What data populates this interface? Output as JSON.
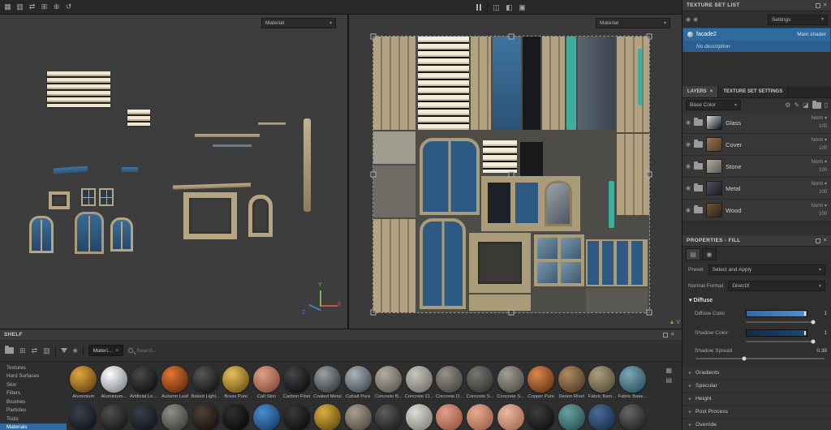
{
  "colors": {
    "accent_blue": "#2f6b9e",
    "viewport_bg": "#3d3d3d",
    "beige": "#b5a583",
    "door_blue": "#2e5f86",
    "teal": "#3fae9e",
    "diffuse_bar": "#3d7fc4",
    "shadow_bar": "#14395e"
  },
  "topbar": {
    "left_icons": [
      {
        "name": "uv-grid-icon",
        "glyph": "▦"
      },
      {
        "name": "layout-grid-icon",
        "glyph": "▥"
      },
      {
        "name": "swap-views-icon",
        "glyph": "⇄"
      },
      {
        "name": "split-view-icon",
        "glyph": "⊞"
      },
      {
        "name": "add-view-icon",
        "glyph": "⊕"
      },
      {
        "name": "history-icon",
        "glyph": "↺"
      }
    ],
    "right_icons": [
      {
        "name": "display-settings-icon",
        "glyph": "◫"
      },
      {
        "name": "render-mode-icon",
        "glyph": "◧"
      },
      {
        "name": "camera-icon",
        "glyph": "▣"
      }
    ]
  },
  "viewport3d": {
    "material_dropdown": "Material",
    "axes": {
      "x": "X",
      "y": "Y",
      "z": "Z"
    }
  },
  "viewport2d": {
    "material_dropdown": "Material",
    "axis_v": "V"
  },
  "texture_set_list": {
    "title": "TEXTURE SET LIST",
    "settings_button": "Settings",
    "set_name": "facade2",
    "shader": "Main shader",
    "description": "No description"
  },
  "layers_panel": {
    "tab_layers": "LAYERS",
    "tab_settings": "TEXTURE SET SETTINGS",
    "channel": "Base Color",
    "layers": [
      {
        "name": "Glass",
        "blend": "Norm",
        "opacity": "100",
        "t1": "#d6dadc",
        "t2": "#10151a"
      },
      {
        "name": "Cover",
        "blend": "Norm",
        "opacity": "100",
        "t1": "#9a7450",
        "t2": "#4e3a26"
      },
      {
        "name": "Stone",
        "blend": "Norm",
        "opacity": "100",
        "t1": "#b0aca2",
        "t2": "#5e5a52"
      },
      {
        "name": "Metal",
        "blend": "Norm",
        "opacity": "100",
        "t1": "#4e525a",
        "t2": "#1a1d22"
      },
      {
        "name": "Wood",
        "blend": "Norm",
        "opacity": "100",
        "t1": "#6e5638",
        "t2": "#2c2216"
      }
    ]
  },
  "properties": {
    "title": "PROPERTIES - FILL",
    "preset_label": "Preset",
    "preset_value": "Select and Apply",
    "normal_format_label": "Normal Format",
    "normal_format_value": "DirectX",
    "diffuse_section": "Diffuse",
    "diffuse_color": {
      "label": "Diffuse Color",
      "value": "1"
    },
    "shadow_color": {
      "label": "Shadow Color",
      "value": "1"
    },
    "shadow_spread": {
      "label": "Shadow Spread",
      "value": "0.38"
    },
    "sections": [
      {
        "label": "Gradients"
      },
      {
        "label": "Specular"
      },
      {
        "label": "Height"
      },
      {
        "label": "Post Process"
      },
      {
        "label": "Override"
      }
    ]
  },
  "shelf": {
    "title": "SHELF",
    "filter_tag": "Materi...",
    "search_placeholder": "Search...",
    "categories": [
      {
        "label": "Textures"
      },
      {
        "label": "Hard Surfaces"
      },
      {
        "label": "Skin"
      },
      {
        "label": "Filters"
      },
      {
        "label": "Brushes"
      },
      {
        "label": "Particles"
      },
      {
        "label": "Tools"
      },
      {
        "label": "Materials",
        "selected": true
      }
    ],
    "materials": [
      {
        "name": "Aluminium",
        "c1": "#e0a83c",
        "c2": "#6e4a14"
      },
      {
        "name": "Aluminium...",
        "c1": "#ffffff",
        "c2": "#8a8f94"
      },
      {
        "name": "Artificial Lea...",
        "c1": "#4a4a4e",
        "c2": "#141416"
      },
      {
        "name": "Autumn Leaf",
        "c1": "#e07830",
        "c2": "#70300e"
      },
      {
        "name": "Baked Light...",
        "c1": "#585858",
        "c2": "#181818"
      },
      {
        "name": "Brass Pure",
        "c1": "#e8c05a",
        "c2": "#7a5c1a"
      },
      {
        "name": "Calf Skin",
        "c1": "#e0a088",
        "c2": "#8a5240"
      },
      {
        "name": "Carbon Fiber",
        "c1": "#46464c",
        "c2": "#121214"
      },
      {
        "name": "Coated Metal",
        "c1": "#9aa0a4",
        "c2": "#3c4044"
      },
      {
        "name": "Cobalt Pure",
        "c1": "#aab2ba",
        "c2": "#4a5258"
      },
      {
        "name": "Concrete B...",
        "c1": "#b4aea2",
        "c2": "#625e54"
      },
      {
        "name": "Concrete Cl...",
        "c1": "#c8c6be",
        "c2": "#787670"
      },
      {
        "name": "Concrete D...",
        "c1": "#969288",
        "c2": "#4c4a44"
      },
      {
        "name": "Concrete S...",
        "c1": "#787872",
        "c2": "#383836"
      },
      {
        "name": "Concrete S...",
        "c1": "#a29e96",
        "c2": "#55524c"
      },
      {
        "name": "Copper Pure",
        "c1": "#da8850",
        "c2": "#6e3a1a"
      },
      {
        "name": "Denim Rivet",
        "c1": "#b08a62",
        "c2": "#5a4228"
      },
      {
        "name": "Fabric Bam...",
        "c1": "#aaa07e",
        "c2": "#5c543e"
      },
      {
        "name": "Fabric Base...",
        "c1": "#7aa8b4",
        "c2": "#34586a"
      }
    ],
    "materials_row2": [
      {
        "name": "",
        "c1": "#3c424e",
        "c2": "#12161e"
      },
      {
        "name": "",
        "c1": "#50504e",
        "c2": "#1a1a1a"
      },
      {
        "name": "",
        "c1": "#3a4048",
        "c2": "#14181e"
      },
      {
        "name": "",
        "c1": "#8e8e8a",
        "c2": "#44443f"
      },
      {
        "name": "",
        "c1": "#4e4238",
        "c2": "#1a140e"
      },
      {
        "name": "",
        "c1": "#303030",
        "c2": "#0c0c0c"
      },
      {
        "name": "",
        "c1": "#4e8cd0",
        "c2": "#1a4474"
      },
      {
        "name": "",
        "c1": "#3a3a3a",
        "c2": "#101010"
      },
      {
        "name": "",
        "c1": "#d8b040",
        "c2": "#6e5210"
      },
      {
        "name": "",
        "c1": "#a89e8e",
        "c2": "#565048"
      },
      {
        "name": "",
        "c1": "#5e5e5e",
        "c2": "#222222"
      },
      {
        "name": "",
        "c1": "#dcdcd6",
        "c2": "#8a8a84"
      },
      {
        "name": "",
        "c1": "#e0a088",
        "c2": "#9a5a44"
      },
      {
        "name": "",
        "c1": "#e8ac94",
        "c2": "#a2644c"
      },
      {
        "name": "",
        "c1": "#ecb8a0",
        "c2": "#aa7058"
      },
      {
        "name": "",
        "c1": "#3e3e3e",
        "c2": "#121212"
      },
      {
        "name": "",
        "c1": "#6aa0a0",
        "c2": "#2a5858"
      },
      {
        "name": "",
        "c1": "#4a6a96",
        "c2": "#1c3452"
      },
      {
        "name": "",
        "c1": "#686868",
        "c2": "#262626"
      }
    ]
  }
}
